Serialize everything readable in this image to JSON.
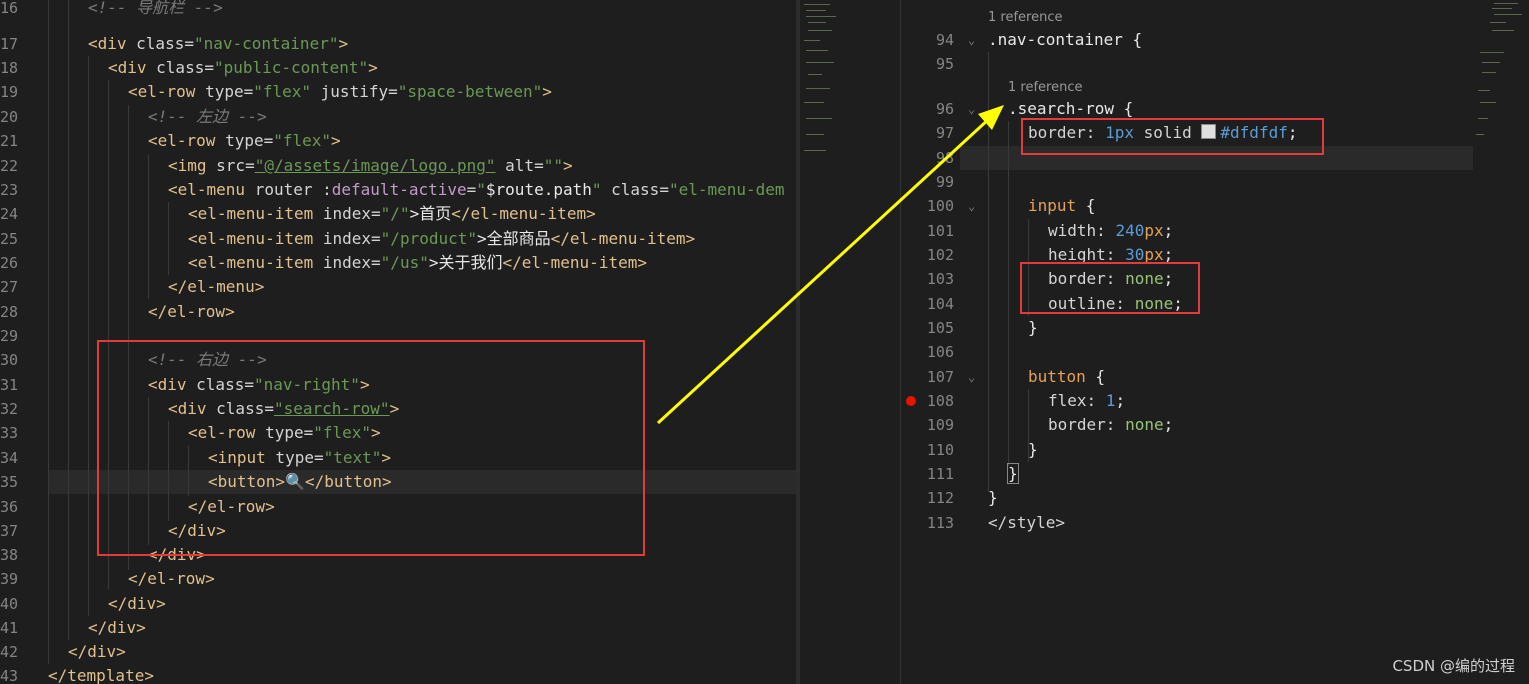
{
  "left_editor": {
    "line_numbers": [
      "16",
      "17",
      "18",
      "19",
      "20",
      "21",
      "22",
      "23",
      "24",
      "25",
      "26",
      "27",
      "28",
      "29",
      "30",
      "31",
      "32",
      "33",
      "34",
      "35",
      "36",
      "37",
      "38",
      "39",
      "40",
      "41",
      "42",
      "43"
    ],
    "lines": {
      "l16_comment": "<!-- 导航栏 -->",
      "l17_open": "<div",
      "l17_attr": " class=",
      "l17_val": "\"nav-container\"",
      "l17_close": ">",
      "l18_open": "<div",
      "l18_attr": " class=",
      "l18_val": "\"public-content\"",
      "l18_close": ">",
      "l19_open": "<el-row",
      "l19_attr1": " type=",
      "l19_val1": "\"flex\"",
      "l19_attr2": " justify=",
      "l19_val2": "\"space-between\"",
      "l19_close": ">",
      "l20_comment": "<!-- 左边 -->",
      "l21_open": "<el-row",
      "l21_attr": " type=",
      "l21_val": "\"flex\"",
      "l21_close": ">",
      "l22_open": "<img",
      "l22_attr1": " src=",
      "l22_val1": "\"@/assets/image/logo.png\"",
      "l22_attr2": " alt=",
      "l22_val2": "\"\"",
      "l22_close": ">",
      "l23_open": "<el-menu",
      "l23_attr1": " router :",
      "l23_attr2": "default-active",
      "l23_eq": "=",
      "l23_val1": "\"",
      "l23_expr": "$route.path",
      "l23_val2": "\"",
      "l23_attr3": " class=",
      "l23_val3": "\"el-menu-dem",
      "l24_open": "<el-menu-item",
      "l24_attr": " index=",
      "l24_val": "\"/\"",
      "l24_text": ">首页",
      "l24_close": "</el-menu-item>",
      "l25_open": "<el-menu-item",
      "l25_attr": " index=",
      "l25_val": "\"/product\"",
      "l25_text": ">全部商品",
      "l25_close": "</el-menu-item>",
      "l26_open": "<el-menu-item",
      "l26_attr": " index=",
      "l26_val": "\"/us\"",
      "l26_text": ">关于我们",
      "l26_close": "</el-menu-item>",
      "l27_close": "</el-menu>",
      "l28_close": "</el-row>",
      "l30_comment": "<!-- 右边 -->",
      "l31_open": "<div",
      "l31_attr": " class=",
      "l31_val": "\"nav-right\"",
      "l31_close": ">",
      "l32_open": "<div",
      "l32_attr": " class=",
      "l32_val": "\"search-row\"",
      "l32_close": ">",
      "l33_open": "<el-row",
      "l33_attr": " type=",
      "l33_val": "\"flex\"",
      "l33_close": ">",
      "l34_open": "<input",
      "l34_attr": " type=",
      "l34_val": "\"text\"",
      "l34_close": ">",
      "l35_open": "<button>",
      "l35_text": "🔍",
      "l35_close": "</button>",
      "l36_close": "</el-row>",
      "l37_close": "</div>",
      "l38_close": "</div>",
      "l39_close": "</el-row>",
      "l40_close": "</div>",
      "l41_close": "</div>",
      "l42_close": "</div>",
      "l43_close": "</template>"
    }
  },
  "right_editor": {
    "line_numbers": [
      "94",
      "95",
      "96",
      "97",
      "98",
      "99",
      "100",
      "101",
      "102",
      "103",
      "104",
      "105",
      "106",
      "107",
      "108",
      "109",
      "110",
      "111",
      "112",
      "113"
    ],
    "references": [
      "1 reference",
      "1 reference"
    ],
    "lines": {
      "l94_sel": ".nav-container",
      "l94_brace": " {",
      "l96_sel": ".search-row",
      "l96_brace": " {",
      "l97_prop": "border: ",
      "l97_num": "1px",
      "l97_kw": " solid ",
      "l97_color": "#dfdfdf",
      "l97_end": ";",
      "l100_sel": "input",
      "l100_brace": " {",
      "l101_prop": "width: ",
      "l101_num": "240",
      "l101_unit": "px",
      "l101_end": ";",
      "l102_prop": "height: ",
      "l102_num": "30",
      "l102_unit": "px",
      "l102_end": ";",
      "l103_prop": "border: ",
      "l103_val": "none",
      "l103_end": ";",
      "l104_prop": "outline: ",
      "l104_val": "none",
      "l104_end": ";",
      "l105_brace": "}",
      "l107_sel": "button",
      "l107_brace": " {",
      "l108_prop": "flex: ",
      "l108_num": "1",
      "l108_end": ";",
      "l109_prop": "border: ",
      "l109_val": "none",
      "l109_end": ";",
      "l110_brace": "}",
      "l111_brace": "}",
      "l112_brace": "}",
      "l113_tag": "</style>"
    }
  },
  "watermark": "CSDN @编的过程",
  "colors": {
    "annotation_box": "#e23b3b",
    "arrow": "#ffff00",
    "swatch": "#dfdfdf"
  }
}
